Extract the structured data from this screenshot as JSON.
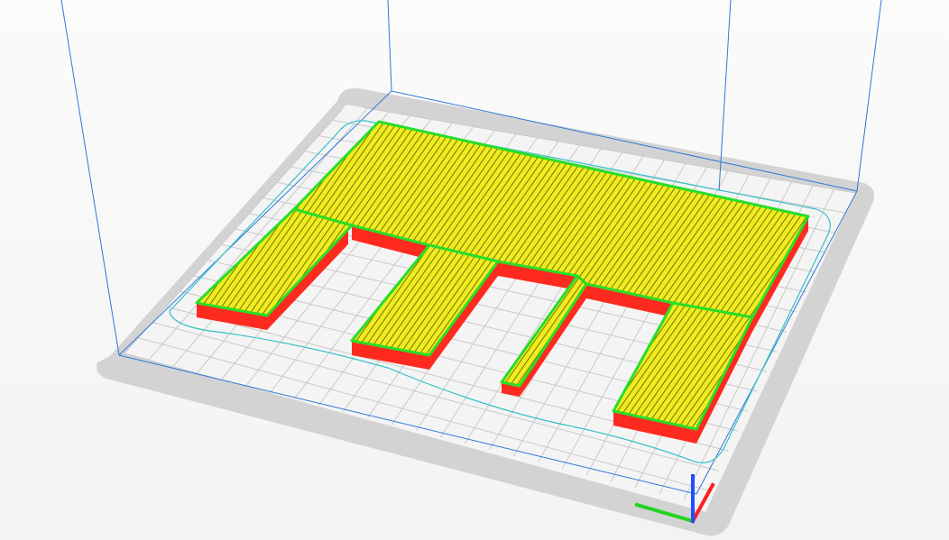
{
  "app": {
    "view": "layer-preview",
    "colors": {
      "background": "#f7f7f7",
      "plate_outer": "#d3d3d3",
      "plate_inner": "#f4f4f4",
      "grid_line": "#c9c9c9",
      "build_volume": "#2f78d6",
      "skirt": "#35c0c9",
      "infill": "#f0ec1e",
      "infill_line": "#4c4a05",
      "perimeter": "#29dd29",
      "side_wall": "#ff2a1f",
      "axis_x": "#ff1f1f",
      "axis_y": "#1f4fff",
      "axis_z": "#22d322"
    }
  },
  "model": {
    "name": "",
    "shapes": [
      "base-slab",
      "leg-1",
      "leg-2",
      "leg-3",
      "leg-4"
    ]
  }
}
